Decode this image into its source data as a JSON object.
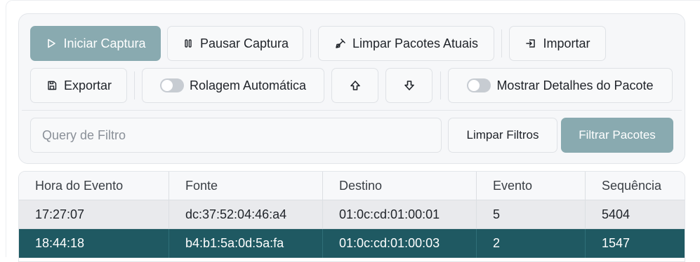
{
  "toolbar": {
    "start_capture": "Iniciar Captura",
    "pause_capture": "Pausar Captura",
    "clear_packets": "Limpar Pacotes Atuais",
    "import": "Importar",
    "export": "Exportar",
    "auto_scroll": "Rolagem Automática",
    "show_details": "Mostrar Detalhes do Pacote",
    "auto_scroll_on": false,
    "show_details_on": false
  },
  "filter": {
    "placeholder": "Query de Filtro",
    "value": "",
    "clear_label": "Limpar Filtros",
    "apply_label": "Filtrar Pacotes"
  },
  "table": {
    "columns": [
      "Hora do Evento",
      "Fonte",
      "Destino",
      "Evento",
      "Sequência"
    ],
    "rows": [
      [
        "17:27:07",
        "dc:37:52:04:46:a4",
        "01:0c:cd:01:00:01",
        "5",
        "5404"
      ],
      [
        "18:44:18",
        "b4:b1:5a:0d:5a:fa",
        "01:0c:cd:01:00:03",
        "2",
        "1547"
      ]
    ],
    "selected_row": 1
  },
  "colors": {
    "primary_button": "#89aab0",
    "selected_row": "#1f5962"
  }
}
